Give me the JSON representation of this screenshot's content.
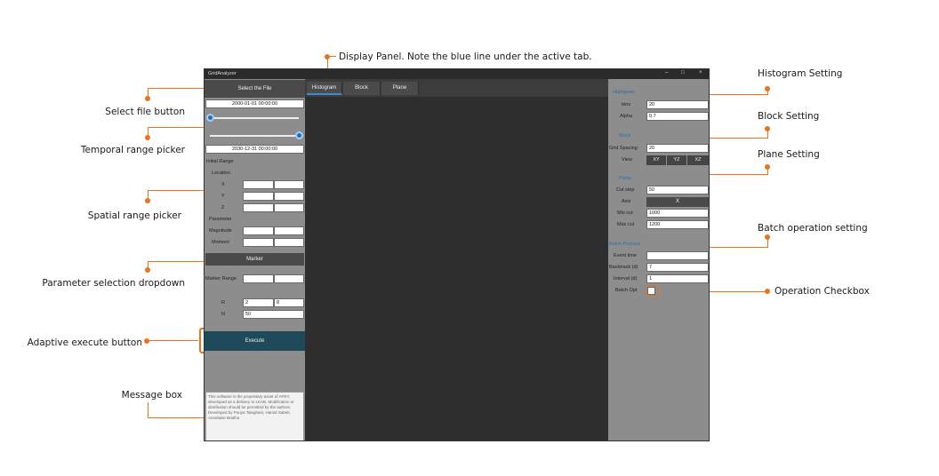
{
  "annotations": {
    "display_panel": "Display Panel. Note the blue line under the active tab.",
    "select_file": "Select file button",
    "temporal_range": "Temporal range picker",
    "spatial_range": "Spatial range picker",
    "parameter_dropdown": "Parameter selection dropdown",
    "execute": "Adaptive execute button",
    "message_box": "Message box",
    "histogram_setting": "Histogram Setting",
    "block_setting": "Block Setting",
    "plane_setting": "Plane Setting",
    "batch_setting": "Batch operation setting",
    "operation_checkbox": "Operation Checkbox"
  },
  "window": {
    "title": "GridAnalyzer",
    "minimize": "–",
    "maximize": "□",
    "close": "×"
  },
  "left_panel": {
    "select_file_label": "Select the File",
    "start_date": "2000-01-01 00:00:00",
    "end_date": "2030-12-31 00:00:00",
    "initial_range_label": "Initial Range",
    "location_label": "Location",
    "x_label": "X",
    "y_label": "Y",
    "z_label": "Z",
    "parameter_label": "Parameter",
    "magnitude_label": "Magnitude",
    "moment_label": "Moment",
    "marker_select": "Marker",
    "marker_range_label": "Marker Range",
    "r_label": "R",
    "r_min": "2",
    "r_max": "8",
    "n_label": "N",
    "n_value": "50",
    "execute_label": "Execute",
    "message_text": "This software is the proprietary asset of AFRY, developed as a delivery to LKAB. Modification or distribution should be permitted by the authors. Developed by Pouya Taleghani, Hamid Sabeti, Annelaise Bratihu"
  },
  "tabs": [
    {
      "label": "Histogram",
      "active": true
    },
    {
      "label": "Block",
      "active": false
    },
    {
      "label": "Plane",
      "active": false
    }
  ],
  "right_panel": {
    "histogram_title": "Histogram",
    "bins_label": "bins",
    "bins_value": "20",
    "alpha_label": "Alpha",
    "alpha_value": "0.7",
    "block_title": "Block",
    "grid_spacing_label": "Grid Spacing",
    "grid_spacing_value": "20",
    "view_label": "View",
    "view_options": [
      "XY",
      "YZ",
      "XZ"
    ],
    "plane_title": "Plane",
    "cut_step_label": "Cut step",
    "cut_step_value": "50",
    "axis_label": "Axis",
    "axis_value": "X",
    "min_cut_label": "Min cut",
    "min_cut_value": "1000",
    "max_cut_label": "Max cut",
    "max_cut_value": "1200",
    "batch_title": "Batch Process",
    "event_time_label": "Event time",
    "event_time_value": "",
    "backtrack_label": "Backtrack (d)",
    "backtrack_value": "7",
    "interval_label": "Interval (d)",
    "interval_value": "1",
    "batch_opt_label": "Batch Opt"
  },
  "colors": {
    "accent": "#e8741e",
    "active_tab_line": "#3a8ad6",
    "execute_button": "#1f4a5a",
    "section_title": "#2a6fa8"
  }
}
